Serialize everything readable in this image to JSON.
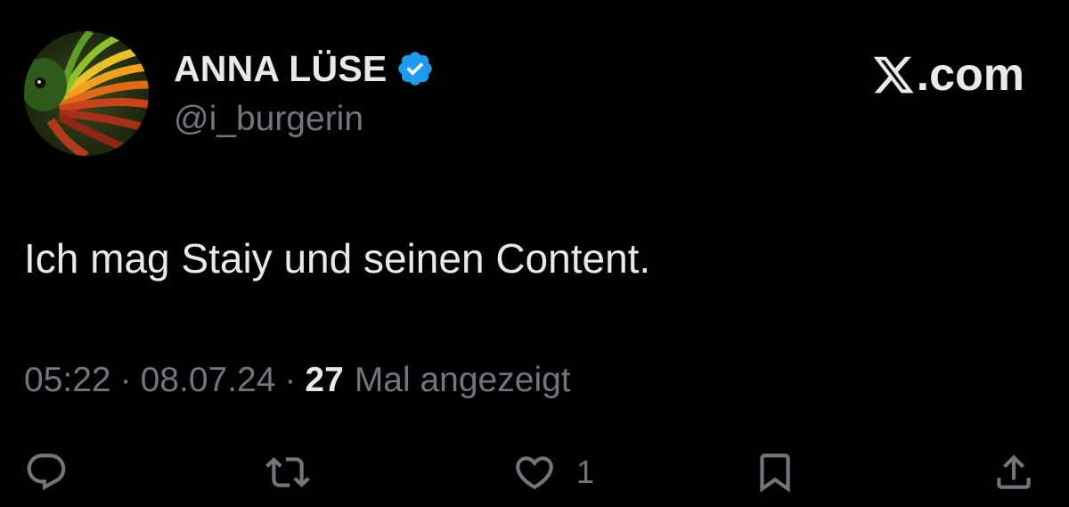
{
  "author": {
    "display_name": "ANNA LÜSE",
    "handle": "@i_burgerin",
    "verified": true,
    "verified_color": "#1d9bf0"
  },
  "brand": {
    "logo_icon": "x-logo-icon",
    "text": ".com"
  },
  "tweet": {
    "text": "Ich mag Staiy und seinen Content."
  },
  "meta": {
    "time": "05:22",
    "separator": "·",
    "date": "08.07.24",
    "views_count": "27",
    "views_label": "Mal angezeigt"
  },
  "actions": {
    "reply_icon": "reply-icon",
    "retweet_icon": "retweet-icon",
    "like_icon": "heart-icon",
    "like_count": "1",
    "bookmark_icon": "bookmark-icon",
    "share_icon": "share-icon"
  },
  "colors": {
    "background": "#000000",
    "primary_text": "#e7e9ea",
    "secondary_text": "#71767b"
  }
}
